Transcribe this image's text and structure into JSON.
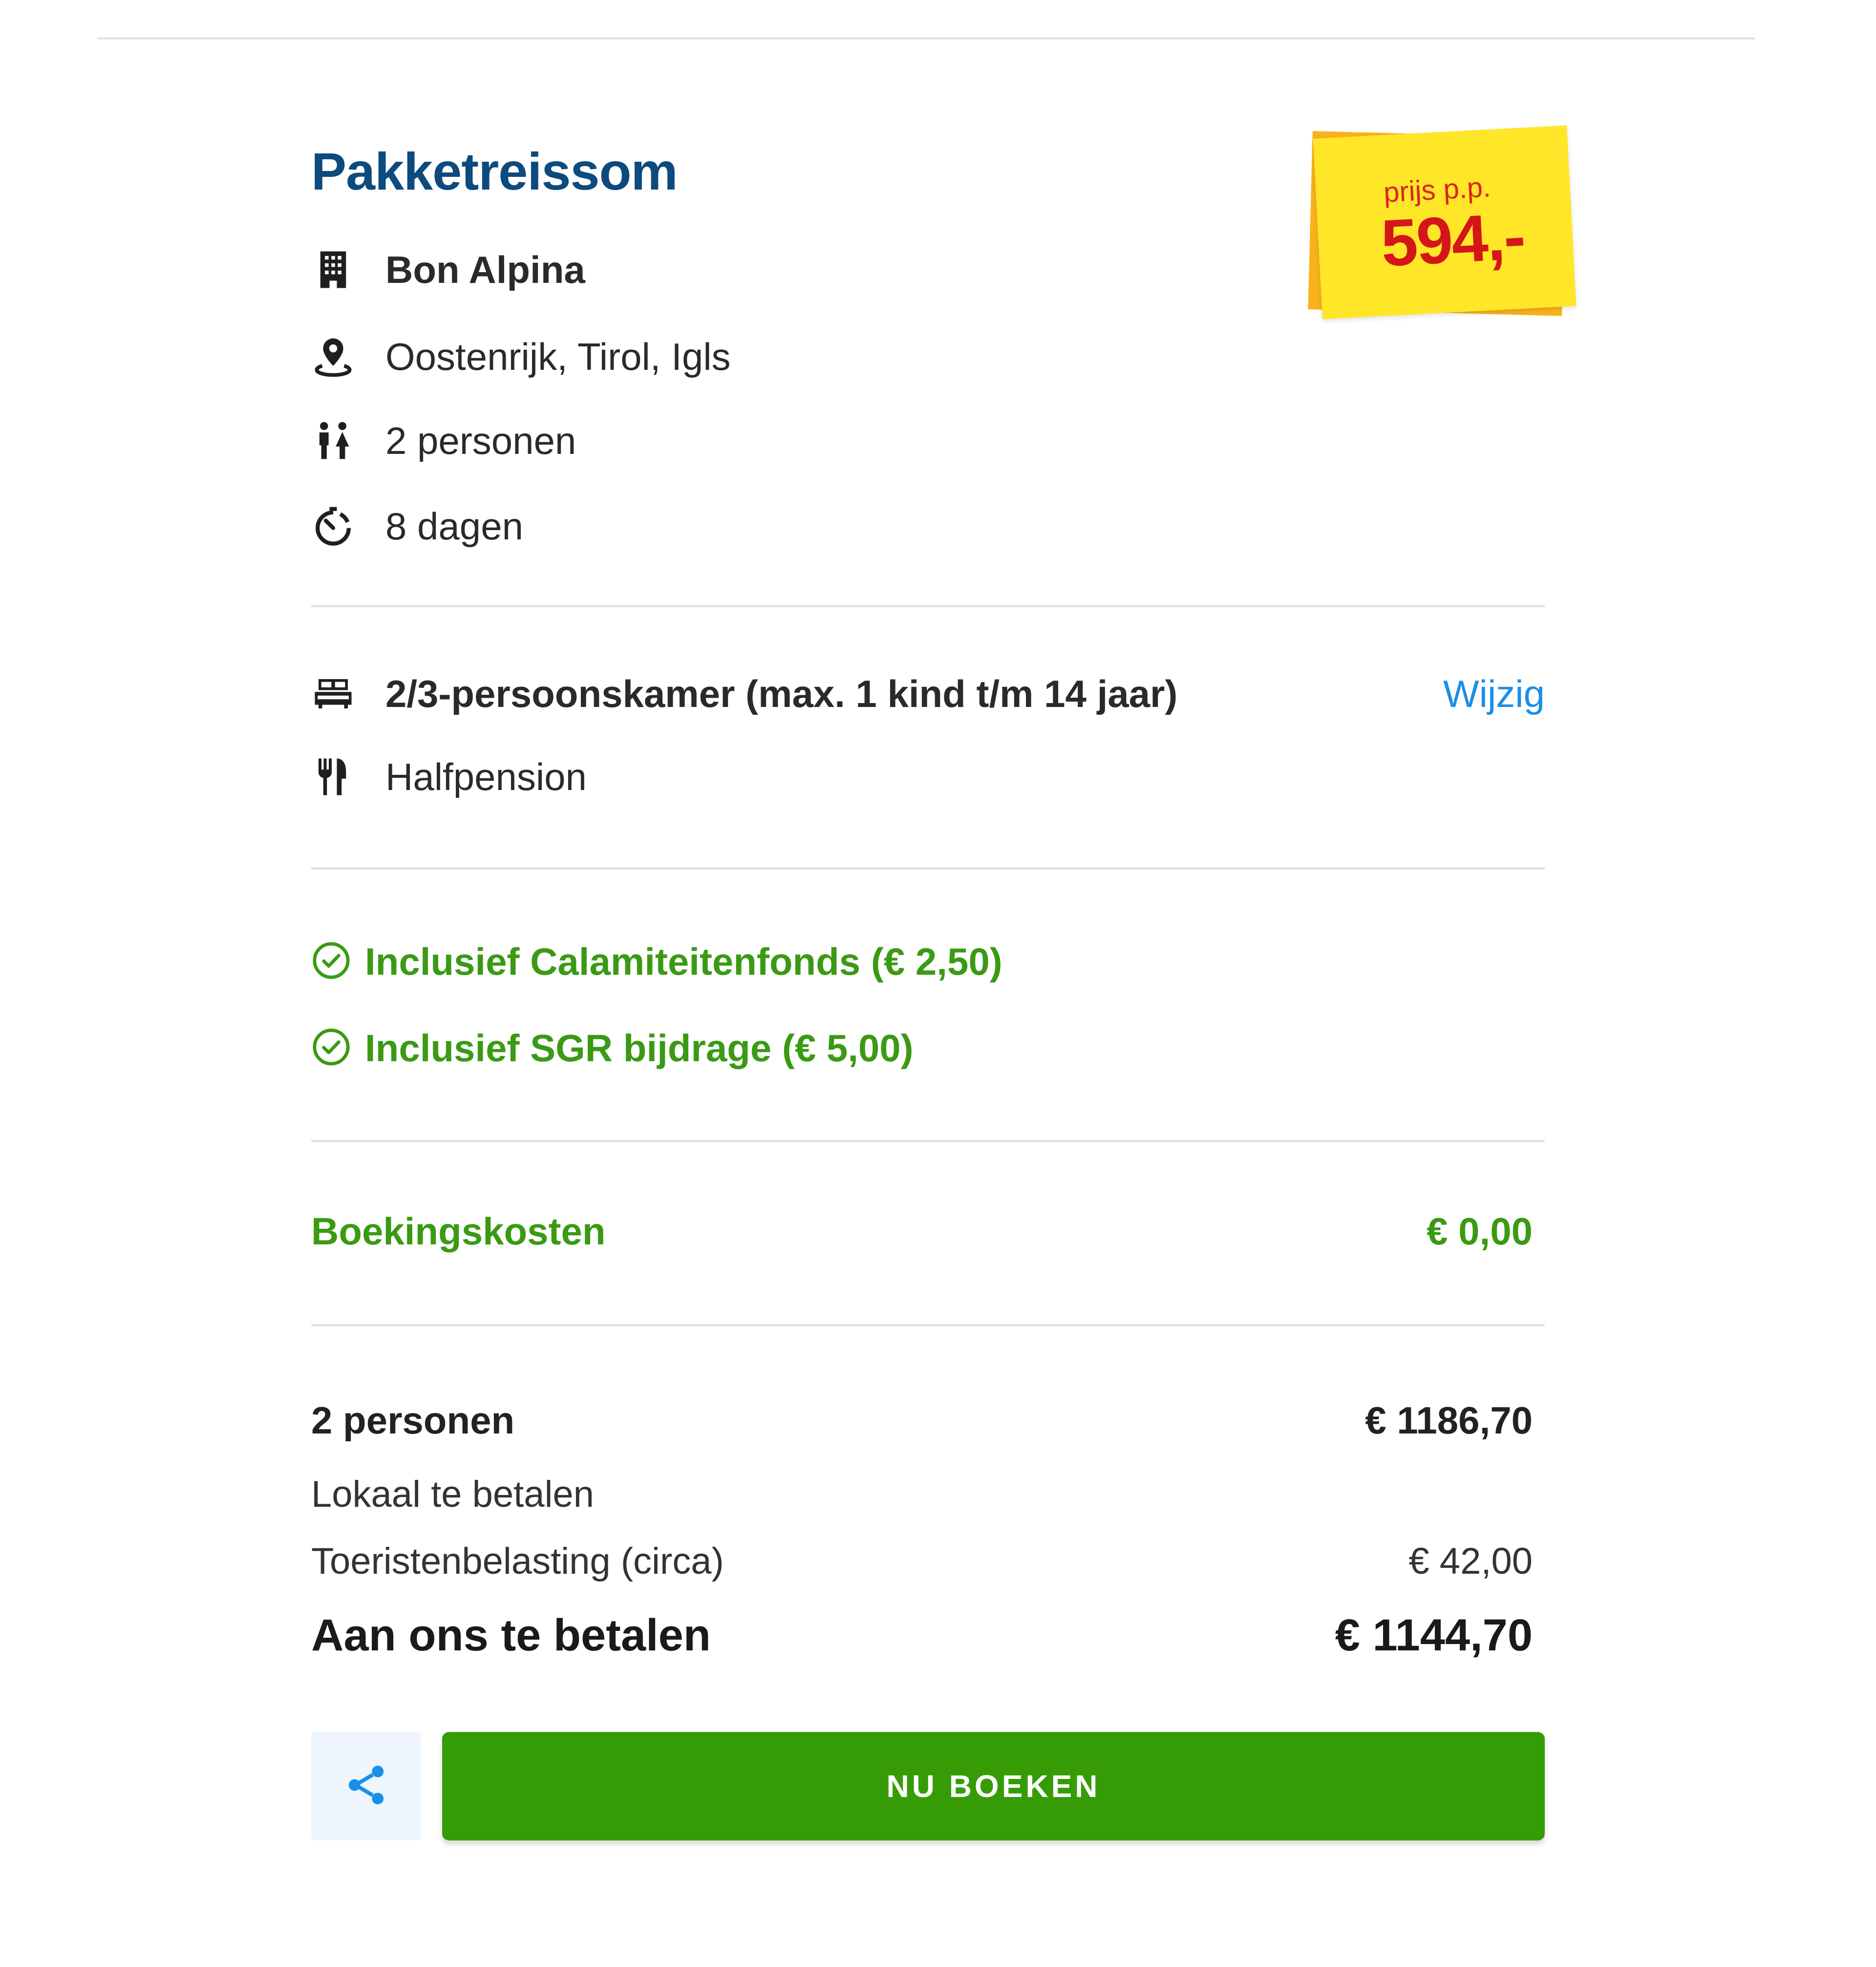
{
  "package": {
    "title": "Pakketreissom",
    "hotel": "Bon Alpina",
    "location": "Oostenrijk, Tirol, Igls",
    "persons": "2 personen",
    "duration": "8 dagen",
    "icons": {
      "hotel": "building-icon",
      "location": "map-pin-icon",
      "persons": "people-icon",
      "duration": "timer-icon"
    }
  },
  "sticker": {
    "label": "prijs p.p.",
    "price": "594,-",
    "colors": {
      "front": "#ffe629",
      "back": "#f9b21c",
      "text": "#d41618"
    }
  },
  "room": {
    "type": "2/3-persoonskamer (max. 1 kind t/m 14 jaar)",
    "change_link": "Wijzig",
    "board": "Halfpension",
    "icons": {
      "room": "bed-icon",
      "board": "cutlery-icon"
    }
  },
  "inclusions": [
    {
      "label": "Inclusief Calamiteitenfonds (€ 2,50)",
      "icon": "check-circle-icon"
    },
    {
      "label": "Inclusief SGR bijdrage (€ 5,00)",
      "icon": "check-circle-icon"
    }
  ],
  "booking_costs": {
    "label": "Boekingskosten",
    "value": "€ 0,00"
  },
  "summary": {
    "persons_label": "2 personen",
    "persons_value": "€ 1186,70",
    "local_label": "Lokaal te betalen",
    "tax_label": "Toeristenbelasting (circa)",
    "tax_value": "€ 42,00",
    "total_label": "Aan ons te betalen",
    "total_value": "€ 1144,70"
  },
  "actions": {
    "share_icon": "share-icon",
    "book_label": "NU BOEKEN"
  },
  "colors": {
    "title": "#0d4a7e",
    "green": "#3a9a14",
    "button": "#369c06",
    "link": "#1a8fe8"
  }
}
